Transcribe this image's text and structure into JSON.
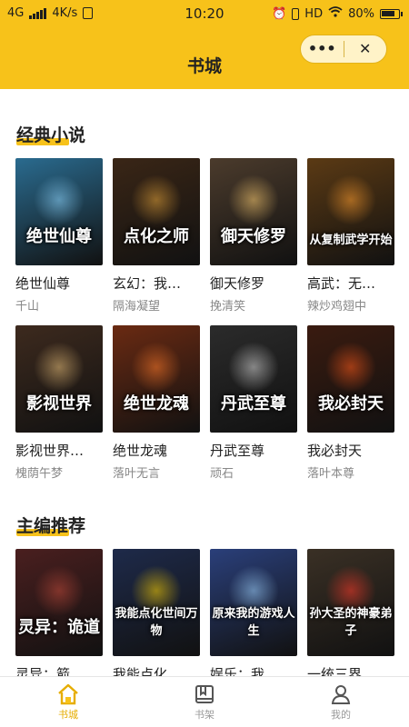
{
  "status_bar": {
    "network": "4G",
    "speed": "4K/s",
    "time": "10:20",
    "network_type": "HD",
    "battery": "80%",
    "battery_level": 0.8
  },
  "header": {
    "title": "书城",
    "menu_label": "•••",
    "close_label": "✕"
  },
  "sections": [
    {
      "heading": "经典小说",
      "books": [
        {
          "cover_text": "绝世仙尊",
          "title": "绝世仙尊",
          "author": "千山",
          "bg": "#2a6b8f",
          "accent": "#8fd6ff"
        },
        {
          "cover_text": "点化之师",
          "title": "玄幻：我…",
          "author": "隔海凝望",
          "bg": "#3a2616",
          "accent": "#e5a43a"
        },
        {
          "cover_text": "御天修罗",
          "title": "御天修罗",
          "author": "挽清笑",
          "bg": "#4b3b2c",
          "accent": "#ffcf73"
        },
        {
          "cover_text": "从复制武学开始",
          "title": "高武：无…",
          "author": "辣炒鸡翅中",
          "bg": "#5b3a14",
          "accent": "#ff9d2e"
        }
      ]
    },
    {
      "heading": "",
      "books": [
        {
          "cover_text": "影视世界",
          "title": "影视世界…",
          "author": "槐荫午梦",
          "bg": "#3d2a1e",
          "accent": "#e9c07a"
        },
        {
          "cover_text": "绝世龙魂",
          "title": "绝世龙魂",
          "author": "落叶无言",
          "bg": "#6a2a12",
          "accent": "#ff7a2a"
        },
        {
          "cover_text": "丹武至尊",
          "title": "丹武至尊",
          "author": "顽石",
          "bg": "#2b2b2b",
          "accent": "#d9d9d9"
        },
        {
          "cover_text": "我必封天",
          "title": "我必封天",
          "author": "落叶本尊",
          "bg": "#3a1b10",
          "accent": "#ff5a1a"
        }
      ]
    },
    {
      "heading": "主编推荐",
      "books": [
        {
          "cover_text": "灵异：诡道",
          "title": "灵异：箭…",
          "author": "",
          "bg": "#4a1f1f",
          "accent": "#c14a3a"
        },
        {
          "cover_text": "我能点化世间万物",
          "title": "我能点化…",
          "author": "",
          "bg": "#1e2a4a",
          "accent": "#ffd400"
        },
        {
          "cover_text": "原来我的游戏人生",
          "title": "娱乐：我…",
          "author": "",
          "bg": "#2a3f7a",
          "accent": "#9fd3ff"
        },
        {
          "cover_text": "孙大圣的神豪弟子",
          "title": "一统三界…",
          "author": "",
          "bg": "#3a3025",
          "accent": "#ff3b2a"
        }
      ]
    }
  ],
  "tabbar": {
    "items": [
      {
        "label": "书城",
        "icon": "home-icon",
        "active": true
      },
      {
        "label": "书架",
        "icon": "bookshelf-icon",
        "active": false
      },
      {
        "label": "我的",
        "icon": "profile-icon",
        "active": false
      }
    ],
    "active_color": "#e6ad00",
    "inactive_color": "#999999"
  },
  "colors": {
    "header_bg": "#f7c21a",
    "accent": "#f7c21a"
  }
}
